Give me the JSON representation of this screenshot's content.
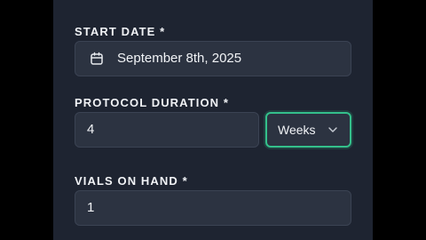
{
  "form": {
    "start_date": {
      "label": "START DATE *",
      "value": "September 8th, 2025",
      "icon": "calendar-icon"
    },
    "protocol_duration": {
      "label": "PROTOCOL DURATION *",
      "value": "4",
      "unit": "Weeks",
      "unit_icon": "chevron-down-icon"
    },
    "vials_on_hand": {
      "label": "VIALS ON HAND *",
      "value": "1"
    }
  },
  "colors": {
    "background": "#1e2431",
    "field": "#2c3341",
    "field_border": "#3b4353",
    "accent": "#34c08b",
    "text": "#f1f3f6"
  }
}
